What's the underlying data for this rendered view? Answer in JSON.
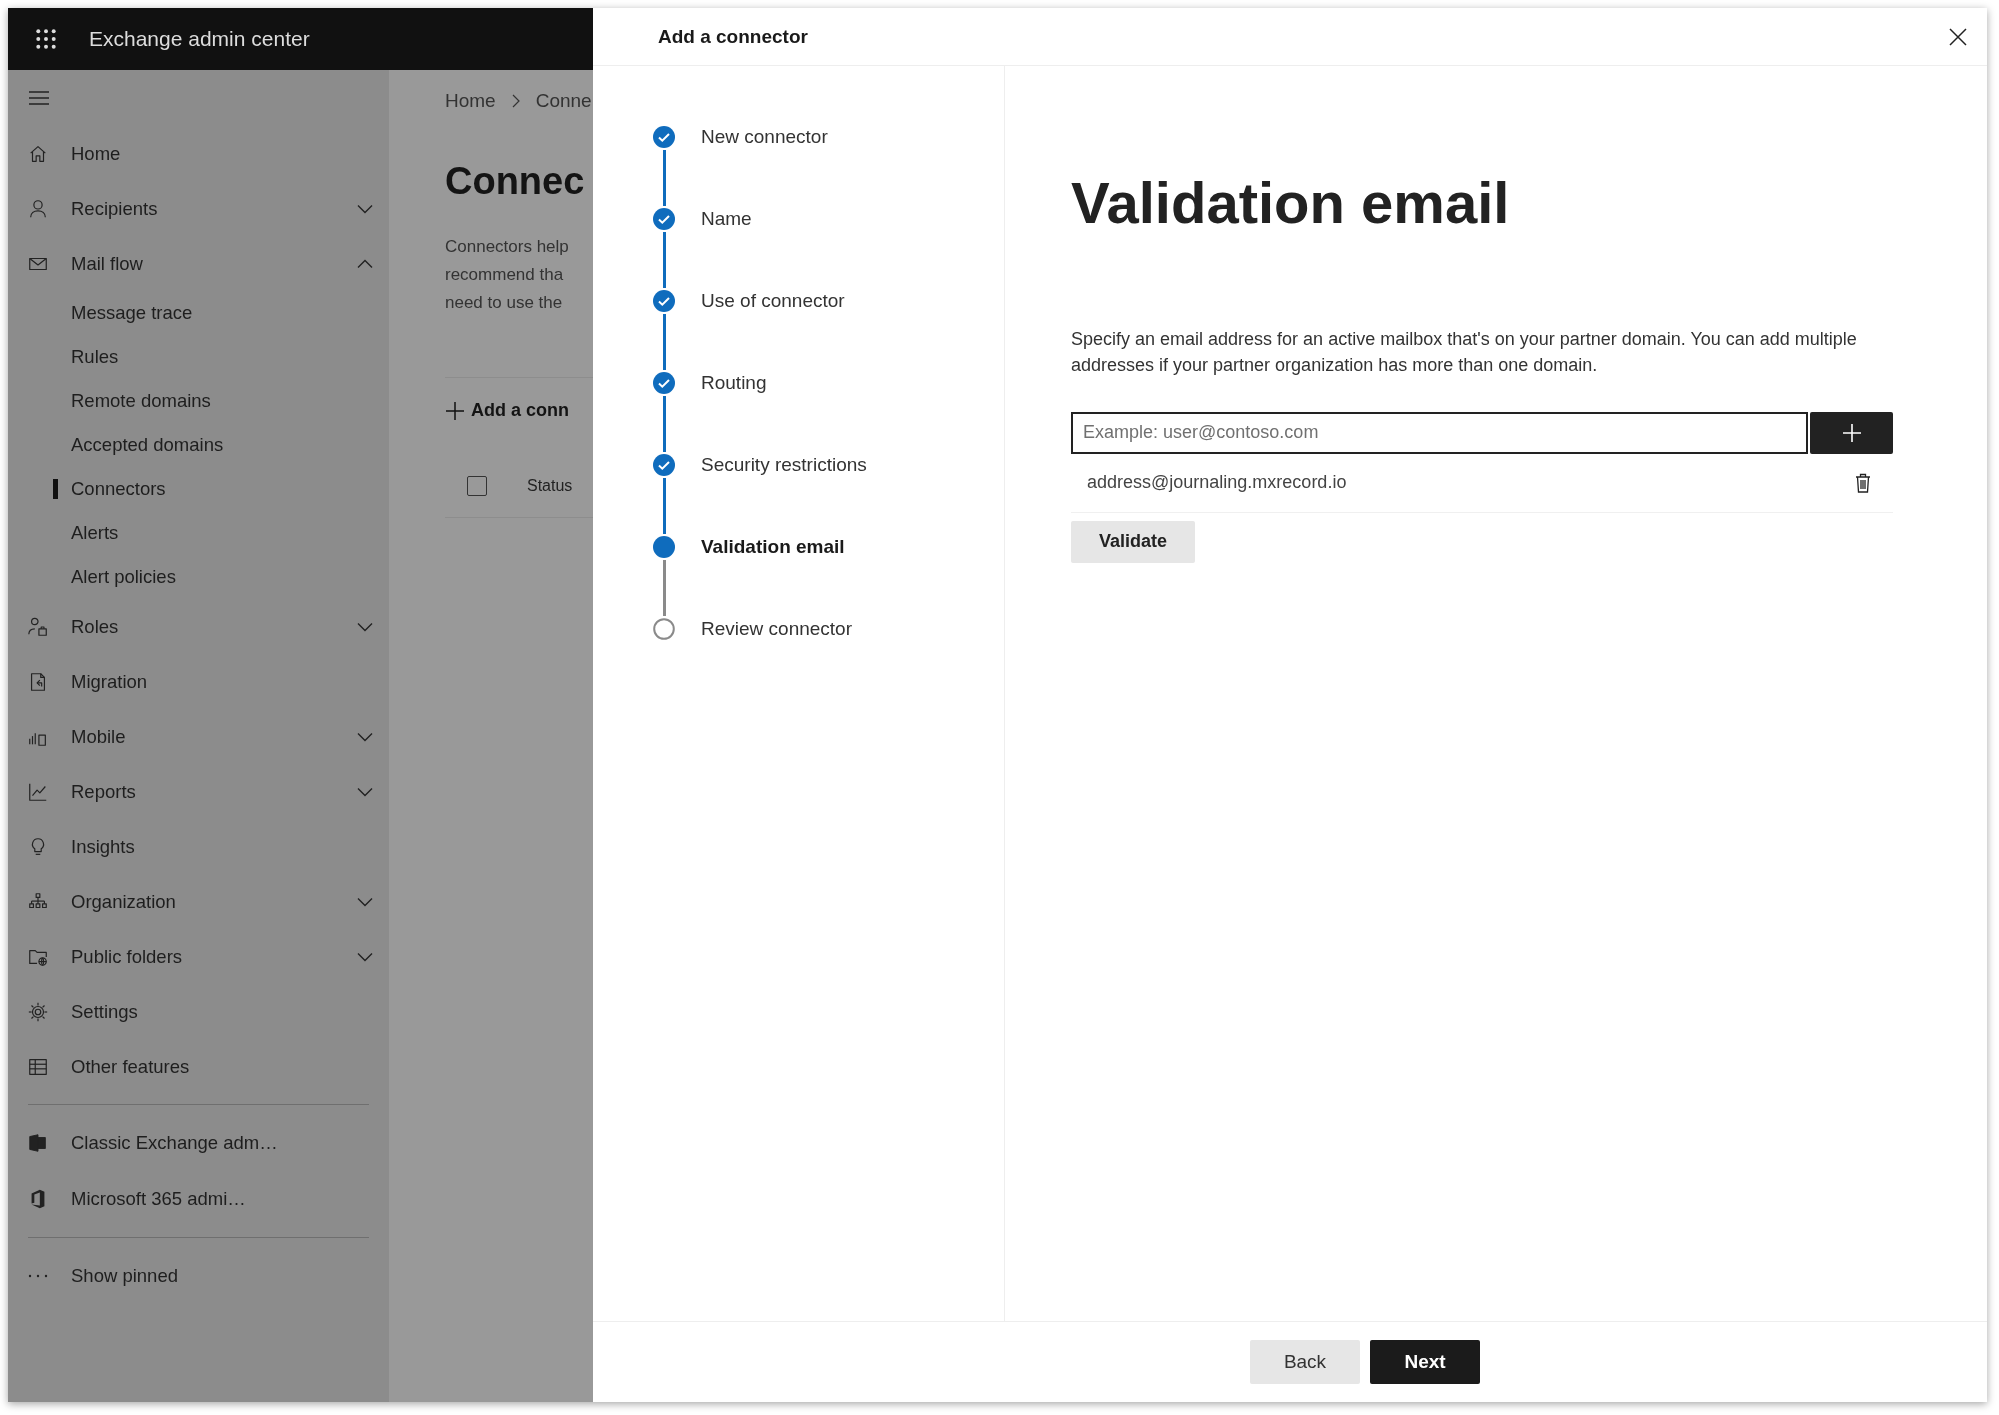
{
  "app_bar": {
    "title": "Exchange admin center"
  },
  "sidebar": {
    "items": [
      {
        "label": "Home"
      },
      {
        "label": "Recipients",
        "expanded": false
      },
      {
        "label": "Mail flow",
        "expanded": true,
        "children": [
          {
            "label": "Message trace",
            "selected": false
          },
          {
            "label": "Rules",
            "selected": false
          },
          {
            "label": "Remote domains",
            "selected": false
          },
          {
            "label": "Accepted domains",
            "selected": false
          },
          {
            "label": "Connectors",
            "selected": true
          },
          {
            "label": "Alerts",
            "selected": false
          },
          {
            "label": "Alert policies",
            "selected": false
          }
        ]
      },
      {
        "label": "Roles",
        "expanded": false
      },
      {
        "label": "Migration"
      },
      {
        "label": "Mobile",
        "expanded": false
      },
      {
        "label": "Reports",
        "expanded": false
      },
      {
        "label": "Insights"
      },
      {
        "label": "Organization",
        "expanded": false
      },
      {
        "label": "Public folders",
        "expanded": false
      },
      {
        "label": "Settings"
      },
      {
        "label": "Other features"
      }
    ],
    "links": [
      "Classic Exchange adm…",
      "Microsoft 365 admi…"
    ],
    "show_pinned": "Show pinned"
  },
  "page": {
    "breadcrumb": [
      "Home",
      "Conne"
    ],
    "heading": "Connec",
    "description": [
      "Connectors help",
      "recommend tha",
      "need to use the"
    ],
    "toolbar_action": "Add a conn",
    "table": {
      "select_all_checked": false,
      "columns": [
        "Status"
      ]
    }
  },
  "panel": {
    "title": "Add a connector",
    "steps": [
      {
        "label": "New connector",
        "completed": true,
        "selected": false
      },
      {
        "label": "Name",
        "completed": true,
        "selected": false
      },
      {
        "label": "Use of connector",
        "completed": true,
        "selected": false
      },
      {
        "label": "Routing",
        "completed": true,
        "selected": false
      },
      {
        "label": "Security restrictions",
        "completed": true,
        "selected": false
      },
      {
        "label": "Validation email",
        "completed": false,
        "selected": true
      },
      {
        "label": "Review connector",
        "completed": false,
        "selected": false
      }
    ],
    "heading": "Validation email",
    "description": "Specify an email address for an active mailbox that's on your partner domain. You can add multiple addresses if your partner organization has more than one domain.",
    "email_field": {
      "placeholder": "Example: user@contoso.com"
    },
    "addresses": [
      "address@journaling.mxrecord.io"
    ],
    "validate_button": "Validate",
    "back_button": "Back",
    "next_button": "Next"
  }
}
